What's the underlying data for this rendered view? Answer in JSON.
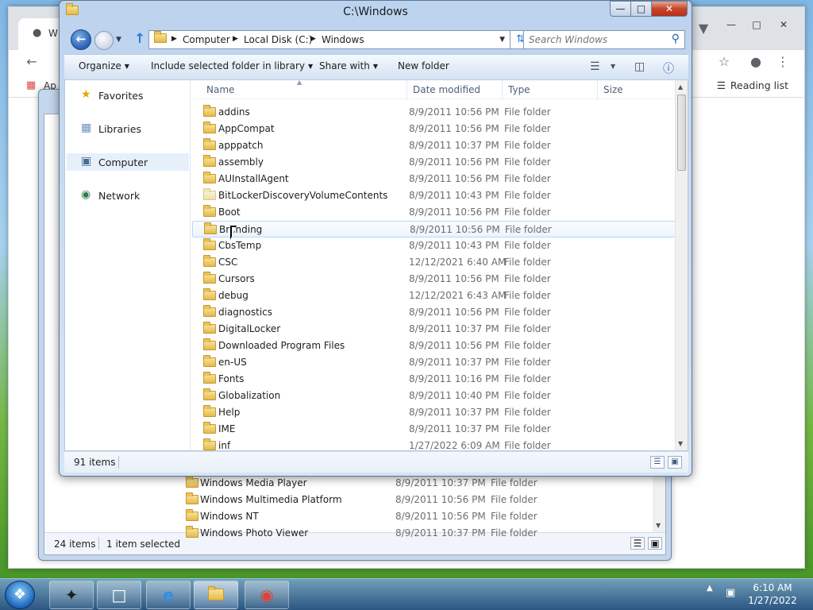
{
  "chrome": {
    "tab_title": "W",
    "bookmark_apps": "Ap",
    "reading_list": "Reading list"
  },
  "background_window": {
    "rows": [
      {
        "name": "Windows Media Player",
        "date": "8/9/2011 10:37 PM",
        "type": "File folder"
      },
      {
        "name": "Windows Multimedia Platform",
        "date": "8/9/2011 10:56 PM",
        "type": "File folder"
      },
      {
        "name": "Windows NT",
        "date": "8/9/2011 10:56 PM",
        "type": "File folder"
      },
      {
        "name": "Windows Photo Viewer",
        "date": "8/9/2011 10:37 PM",
        "type": "File folder"
      }
    ],
    "status_count": "24 items",
    "status_selected": "1 item selected"
  },
  "window": {
    "title": "C:\\Windows",
    "address": {
      "crumbs": [
        "Computer",
        "Local Disk (C:)",
        "Windows"
      ]
    },
    "search_placeholder": "Search Windows",
    "commands": {
      "organize": "Organize",
      "include": "Include selected folder in library",
      "share": "Share with",
      "new_folder": "New folder"
    },
    "nav": {
      "favorites": "Favorites",
      "libraries": "Libraries",
      "computer": "Computer",
      "network": "Network"
    },
    "columns": {
      "name": "Name",
      "date": "Date modified",
      "type": "Type",
      "size": "Size"
    },
    "rows": [
      {
        "name": "addins",
        "date": "8/9/2011 10:56 PM",
        "type": "File folder"
      },
      {
        "name": "AppCompat",
        "date": "8/9/2011 10:56 PM",
        "type": "File folder"
      },
      {
        "name": "apppatch",
        "date": "8/9/2011 10:37 PM",
        "type": "File folder"
      },
      {
        "name": "assembly",
        "date": "8/9/2011 10:56 PM",
        "type": "File folder"
      },
      {
        "name": "AUInstallAgent",
        "date": "8/9/2011 10:56 PM",
        "type": "File folder"
      },
      {
        "name": "BitLockerDiscoveryVolumeContents",
        "date": "8/9/2011 10:43 PM",
        "type": "File folder"
      },
      {
        "name": "Boot",
        "date": "8/9/2011 10:56 PM",
        "type": "File folder"
      },
      {
        "name": "Branding",
        "date": "8/9/2011 10:56 PM",
        "type": "File folder"
      },
      {
        "name": "CbsTemp",
        "date": "8/9/2011 10:43 PM",
        "type": "File folder"
      },
      {
        "name": "CSC",
        "date": "12/12/2021 6:40 AM",
        "type": "File folder"
      },
      {
        "name": "Cursors",
        "date": "8/9/2011 10:56 PM",
        "type": "File folder"
      },
      {
        "name": "debug",
        "date": "12/12/2021 6:43 AM",
        "type": "File folder"
      },
      {
        "name": "diagnostics",
        "date": "8/9/2011 10:56 PM",
        "type": "File folder"
      },
      {
        "name": "DigitalLocker",
        "date": "8/9/2011 10:37 PM",
        "type": "File folder"
      },
      {
        "name": "Downloaded Program Files",
        "date": "8/9/2011 10:56 PM",
        "type": "File folder"
      },
      {
        "name": "en-US",
        "date": "8/9/2011 10:37 PM",
        "type": "File folder"
      },
      {
        "name": "Fonts",
        "date": "8/9/2011 10:16 PM",
        "type": "File folder"
      },
      {
        "name": "Globalization",
        "date": "8/9/2011 10:40 PM",
        "type": "File folder"
      },
      {
        "name": "Help",
        "date": "8/9/2011 10:37 PM",
        "type": "File folder"
      },
      {
        "name": "IME",
        "date": "8/9/2011 10:37 PM",
        "type": "File folder"
      },
      {
        "name": "inf",
        "date": "1/27/2022 6:09 AM",
        "type": "File folder"
      }
    ],
    "status_count": "91 items"
  },
  "taskbar": {
    "time": "6:10 AM",
    "date": "1/27/2022"
  }
}
